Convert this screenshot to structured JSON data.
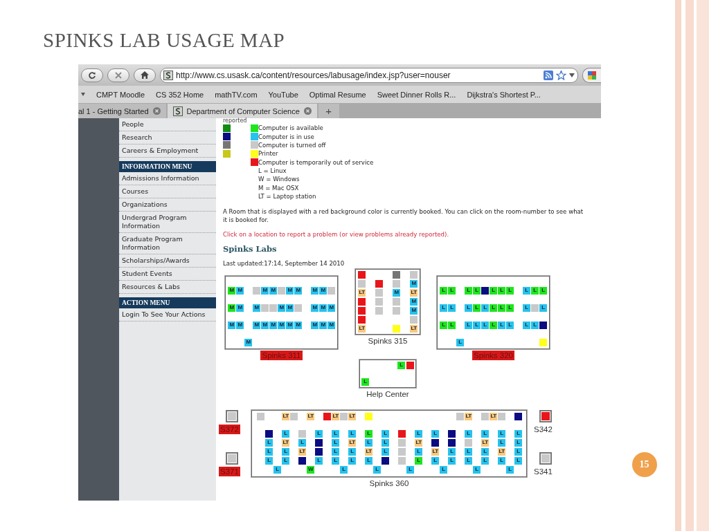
{
  "slide": {
    "title": "SPINKS LAB USAGE MAP",
    "page_number": "15"
  },
  "browser": {
    "url": "http://www.cs.usask.ca/content/resources/labusage/index.jsp?user=nouser",
    "bookmarks": [
      "CMPT Moodle",
      "CS 352 Home",
      "mathTV.com",
      "YouTube",
      "Optimal Resume",
      "Sweet Dinner Rolls R...",
      "Dijkstra's Shortest P..."
    ],
    "tabs": [
      {
        "label": "al 1 - Getting Started",
        "selected": false
      },
      {
        "label": "Department of Computer Science",
        "selected": true
      }
    ],
    "new_tab": "+"
  },
  "sidebar": {
    "sections": [
      {
        "items": [
          "People",
          "Research",
          "Careers & Employment"
        ]
      },
      {
        "header": "INFORMATION MENU",
        "items": [
          "Admissions Information",
          "Courses",
          "Organizations",
          "Undergrad Program Information",
          "Graduate Program Information",
          "Scholarships/Awards",
          "Student Events",
          "Resources & Labs"
        ]
      },
      {
        "header": "ACTION MENU",
        "items": [
          "Login To See Your Actions"
        ]
      }
    ]
  },
  "legend": {
    "heading": "reported",
    "items": [
      {
        "swatches": [
          {
            "color": "#128c12"
          },
          {
            "color": "#1ee61e"
          }
        ],
        "text": "Computer is available"
      },
      {
        "swatches": [
          {
            "color": "#0b0b82"
          },
          {
            "color": "#25c3ee"
          }
        ],
        "text": "Computer is in use"
      },
      {
        "swatches": [
          {
            "color": "#767676"
          },
          {
            "color": "#c9c9c9"
          }
        ],
        "text": "Computer is turned off"
      },
      {
        "swatches": [
          {
            "color": "#c9c71a"
          },
          {
            "color": "#ffff1a"
          }
        ],
        "text": "Printer"
      },
      {
        "swatches": [
          {
            "color": "#e8161a"
          }
        ],
        "text": "Computer is temporarily out of service"
      }
    ],
    "os_codes": [
      "L = Linux",
      "W = Windows",
      "M = Mac OSX",
      "LT = Laptop station"
    ]
  },
  "note": "A Room that is displayed with a red background color is currently booked. You can click on the room-number to see what it is booked for.",
  "report_link": "Click on a location to report a problem (or view problems already reported).",
  "heading": "Spinks Labs",
  "last_updated": "Last updated:17:14, September 14 2010",
  "rooms": [
    {
      "name": "Spinks 311",
      "booked": true,
      "rows": [
        [
          {
            "kind": "station",
            "color": "#1ee61e",
            "label": "M"
          },
          {
            "kind": "station",
            "color": "#25c3ee",
            "label": "M"
          },
          {
            "kind": "gap"
          },
          {
            "kind": "station",
            "color": "#c9c9c9"
          },
          {
            "kind": "station",
            "color": "#25c3ee",
            "label": "M"
          },
          {
            "kind": "station",
            "color": "#25c3ee",
            "label": "M"
          },
          {
            "kind": "station",
            "color": "#c9c9c9"
          },
          {
            "kind": "station",
            "color": "#25c3ee",
            "label": "M"
          },
          {
            "kind": "station",
            "color": "#25c3ee",
            "label": "M"
          },
          {
            "kind": "gap"
          },
          {
            "kind": "station",
            "color": "#25c3ee",
            "label": "M"
          },
          {
            "kind": "station",
            "color": "#25c3ee",
            "label": "M"
          },
          {
            "kind": "station",
            "color": "#c9c9c9"
          }
        ],
        [
          {
            "kind": "station",
            "color": "#1ee61e",
            "label": "M"
          },
          {
            "kind": "station",
            "color": "#25c3ee",
            "label": "M"
          },
          {
            "kind": "gap"
          },
          {
            "kind": "station",
            "color": "#25c3ee",
            "label": "M"
          },
          {
            "kind": "station",
            "color": "#c9c9c9"
          },
          {
            "kind": "station",
            "color": "#c9c9c9"
          },
          {
            "kind": "station",
            "color": "#25c3ee",
            "label": "M"
          },
          {
            "kind": "station",
            "color": "#25c3ee",
            "label": "M"
          },
          {
            "kind": "station",
            "color": "#c9c9c9"
          },
          {
            "kind": "gap"
          },
          {
            "kind": "station",
            "color": "#25c3ee",
            "label": "M"
          },
          {
            "kind": "station",
            "color": "#25c3ee",
            "label": "M"
          },
          {
            "kind": "station",
            "color": "#25c3ee",
            "label": "M"
          }
        ],
        [
          {
            "kind": "station",
            "color": "#25c3ee",
            "label": "M"
          },
          {
            "kind": "station",
            "color": "#25c3ee",
            "label": "M"
          },
          {
            "kind": "gap"
          },
          {
            "kind": "station",
            "color": "#25c3ee",
            "label": "M"
          },
          {
            "kind": "station",
            "color": "#25c3ee",
            "label": "M"
          },
          {
            "kind": "station",
            "color": "#25c3ee",
            "label": "M"
          },
          {
            "kind": "station",
            "color": "#25c3ee",
            "label": "M"
          },
          {
            "kind": "station",
            "color": "#25c3ee",
            "label": "M"
          },
          {
            "kind": "station",
            "color": "#25c3ee",
            "label": "M"
          },
          {
            "kind": "gap"
          },
          {
            "kind": "station",
            "color": "#25c3ee",
            "label": "M"
          },
          {
            "kind": "station",
            "color": "#25c3ee",
            "label": "M"
          },
          {
            "kind": "station",
            "color": "#25c3ee",
            "label": "M"
          }
        ],
        [
          {
            "kind": "gap"
          },
          {
            "kind": "gap"
          },
          {
            "kind": "station",
            "color": "#25c3ee",
            "label": "M"
          }
        ]
      ]
    },
    {
      "name": "Spinks 315",
      "booked": false,
      "rows": [
        [
          {
            "kind": "station",
            "color": "#e8161a"
          },
          {
            "kind": "gap"
          },
          {
            "kind": "station",
            "color": "#767676"
          },
          {
            "kind": "station",
            "color": "#c9c9c9"
          }
        ],
        [
          {
            "kind": "station",
            "color": "#c9c9c9"
          },
          {
            "kind": "station",
            "color": "#e8161a"
          },
          {
            "kind": "station",
            "color": "#c9c9c9"
          },
          {
            "kind": "station",
            "color": "#25c3ee",
            "label": "M"
          }
        ],
        [
          {
            "kind": "station",
            "color": "#f8c97c",
            "label": "LT"
          },
          {
            "kind": "station",
            "color": "#c9c9c9"
          },
          {
            "kind": "station",
            "color": "#25c3ee",
            "label": "M"
          },
          {
            "kind": "station",
            "color": "#f8c97c",
            "label": "LT"
          }
        ],
        [
          {
            "kind": "station",
            "color": "#e8161a"
          },
          {
            "kind": "station",
            "color": "#c9c9c9"
          },
          {
            "kind": "station",
            "color": "#c9c9c9"
          },
          {
            "kind": "station",
            "color": "#25c3ee",
            "label": "M"
          }
        ],
        [
          {
            "kind": "station",
            "color": "#e8161a"
          },
          {
            "kind": "station",
            "color": "#c9c9c9"
          },
          {
            "kind": "station",
            "color": "#c9c9c9"
          },
          {
            "kind": "station",
            "color": "#25c3ee",
            "label": "M"
          }
        ],
        [
          {
            "kind": "station",
            "color": "#e8161a"
          },
          {
            "kind": "gap"
          },
          {
            "kind": "gap"
          },
          {
            "kind": "station",
            "color": "#c9c9c9"
          }
        ],
        [
          {
            "kind": "station",
            "color": "#f8c97c",
            "label": "LT"
          },
          {
            "kind": "gap"
          },
          {
            "kind": "station",
            "color": "#ffff1a"
          },
          {
            "kind": "station",
            "color": "#f8c97c",
            "label": "LT"
          }
        ]
      ]
    },
    {
      "name": "Spinks 320",
      "booked": true,
      "rows": [
        [
          {
            "kind": "station",
            "color": "#1ee61e",
            "label": "L"
          },
          {
            "kind": "station",
            "color": "#1ee61e",
            "label": "L"
          },
          {
            "kind": "gap"
          },
          {
            "kind": "station",
            "color": "#1ee61e",
            "label": "L"
          },
          {
            "kind": "station",
            "color": "#1ee61e",
            "label": "L"
          },
          {
            "kind": "station",
            "color": "#0b0b82"
          },
          {
            "kind": "station",
            "color": "#1ee61e",
            "label": "L"
          },
          {
            "kind": "station",
            "color": "#1ee61e",
            "label": "L"
          },
          {
            "kind": "station",
            "color": "#1ee61e",
            "label": "L"
          },
          {
            "kind": "gap"
          },
          {
            "kind": "station",
            "color": "#25c3ee",
            "label": "L"
          },
          {
            "kind": "station",
            "color": "#1ee61e",
            "label": "L"
          },
          {
            "kind": "station",
            "color": "#1ee61e",
            "label": "L"
          }
        ],
        [
          {
            "kind": "station",
            "color": "#25c3ee",
            "label": "L"
          },
          {
            "kind": "station",
            "color": "#25c3ee",
            "label": "L"
          },
          {
            "kind": "gap"
          },
          {
            "kind": "station",
            "color": "#25c3ee",
            "label": "L"
          },
          {
            "kind": "station",
            "color": "#1ee61e",
            "label": "L"
          },
          {
            "kind": "station",
            "color": "#25c3ee",
            "label": "L"
          },
          {
            "kind": "station",
            "color": "#1ee61e",
            "label": "L"
          },
          {
            "kind": "station",
            "color": "#1ee61e",
            "label": "L"
          },
          {
            "kind": "station",
            "color": "#1ee61e",
            "label": "L"
          },
          {
            "kind": "gap"
          },
          {
            "kind": "station",
            "color": "#25c3ee",
            "label": "L"
          },
          {
            "kind": "station",
            "color": "#c9c9c9"
          },
          {
            "kind": "station",
            "color": "#25c3ee",
            "label": "L"
          }
        ],
        [
          {
            "kind": "station",
            "color": "#1ee61e",
            "label": "L"
          },
          {
            "kind": "station",
            "color": "#1ee61e",
            "label": "L"
          },
          {
            "kind": "gap"
          },
          {
            "kind": "station",
            "color": "#25c3ee",
            "label": "L"
          },
          {
            "kind": "station",
            "color": "#25c3ee",
            "label": "L"
          },
          {
            "kind": "station",
            "color": "#25c3ee",
            "label": "L"
          },
          {
            "kind": "station",
            "color": "#1ee61e",
            "label": "L"
          },
          {
            "kind": "station",
            "color": "#25c3ee",
            "label": "L"
          },
          {
            "kind": "station",
            "color": "#25c3ee",
            "label": "L"
          },
          {
            "kind": "gap"
          },
          {
            "kind": "station",
            "color": "#25c3ee",
            "label": "L"
          },
          {
            "kind": "station",
            "color": "#25c3ee",
            "label": "L"
          },
          {
            "kind": "station",
            "color": "#0b0b82"
          }
        ],
        [
          {
            "kind": "gap"
          },
          {
            "kind": "gap"
          },
          {
            "kind": "station",
            "color": "#25c3ee",
            "label": "L"
          },
          {
            "kind": "gap"
          },
          {
            "kind": "gap"
          },
          {
            "kind": "gap"
          },
          {
            "kind": "gap"
          },
          {
            "kind": "gap"
          },
          {
            "kind": "gap"
          },
          {
            "kind": "gap"
          },
          {
            "kind": "gap"
          },
          {
            "kind": "gap"
          },
          {
            "kind": "station",
            "color": "#ffff1a"
          }
        ]
      ]
    },
    {
      "name": "Help Center",
      "booked": false,
      "rows": [
        [
          {
            "kind": "gap"
          },
          {
            "kind": "gap"
          },
          {
            "kind": "gap"
          },
          {
            "kind": "gap"
          },
          {
            "kind": "station",
            "color": "#1ee61e",
            "label": "L"
          },
          {
            "kind": "station",
            "color": "#e8161a"
          }
        ],
        [
          {
            "kind": "gap"
          }
        ],
        [
          {
            "kind": "station",
            "color": "#1ee61e",
            "label": "L"
          }
        ]
      ]
    }
  ],
  "spinks_360": {
    "name": "Spinks 360",
    "booked": false,
    "top_row": [
      {
        "kind": "station",
        "color": "#c9c9c9"
      },
      {
        "kind": "gap"
      },
      {
        "kind": "gap"
      },
      {
        "kind": "station",
        "color": "#f8c97c",
        "label": "LT"
      },
      {
        "kind": "station",
        "color": "#c9c9c9"
      },
      {
        "kind": "gap"
      },
      {
        "kind": "station",
        "color": "#f8c97c",
        "label": "LT"
      },
      {
        "kind": "gap"
      },
      {
        "kind": "station",
        "color": "#e8161a"
      },
      {
        "kind": "station",
        "color": "#f8c97c",
        "label": "LT"
      },
      {
        "kind": "station",
        "color": "#c9c9c9"
      },
      {
        "kind": "station",
        "color": "#f8c97c",
        "label": "LT"
      },
      {
        "kind": "gap"
      },
      {
        "kind": "station",
        "color": "#ffff1a"
      },
      {
        "kind": "gap"
      },
      {
        "kind": "gap"
      },
      {
        "kind": "gap"
      },
      {
        "kind": "gap"
      },
      {
        "kind": "gap"
      },
      {
        "kind": "gap"
      },
      {
        "kind": "gap"
      },
      {
        "kind": "gap"
      },
      {
        "kind": "gap"
      },
      {
        "kind": "gap"
      },
      {
        "kind": "station",
        "color": "#c9c9c9"
      },
      {
        "kind": "station",
        "color": "#f8c97c",
        "label": "LT"
      },
      {
        "kind": "gap"
      },
      {
        "kind": "station",
        "color": "#c9c9c9"
      },
      {
        "kind": "station",
        "color": "#f8c97c",
        "label": "LT"
      },
      {
        "kind": "station",
        "color": "#c9c9c9"
      },
      {
        "kind": "gap"
      },
      {
        "kind": "station",
        "color": "#0b0b82"
      }
    ],
    "desk_columns": [
      [
        {
          "kind": "station",
          "color": "#0b0b82"
        },
        {
          "kind": "station",
          "color": "#25c3ee",
          "label": "L"
        },
        {
          "kind": "station",
          "color": "#25c3ee",
          "label": "L"
        },
        {
          "kind": "station",
          "color": "#25c3ee",
          "label": "L"
        }
      ],
      [
        {
          "kind": "station",
          "color": "#25c3ee",
          "label": "L"
        },
        {
          "kind": "station",
          "color": "#f8c97c",
          "label": "LT"
        },
        {
          "kind": "station",
          "color": "#25c3ee",
          "label": "L"
        },
        {
          "kind": "station",
          "color": "#25c3ee",
          "label": "L"
        }
      ],
      [
        {
          "kind": "station",
          "color": "#c9c9c9"
        },
        {
          "kind": "station",
          "color": "#25c3ee",
          "label": "L"
        },
        {
          "kind": "station",
          "color": "#f8c97c",
          "label": "LT"
        },
        {
          "kind": "station",
          "color": "#0b0b82"
        }
      ],
      [
        {
          "kind": "station",
          "color": "#25c3ee",
          "label": "L"
        },
        {
          "kind": "station",
          "color": "#0b0b82"
        },
        {
          "kind": "station",
          "color": "#0b0b82"
        },
        {
          "kind": "station",
          "color": "#25c3ee",
          "label": "L"
        }
      ],
      [
        {
          "kind": "station",
          "color": "#25c3ee",
          "label": "L"
        },
        {
          "kind": "station",
          "color": "#25c3ee",
          "label": "L"
        },
        {
          "kind": "station",
          "color": "#25c3ee",
          "label": "L"
        },
        {
          "kind": "station",
          "color": "#25c3ee",
          "label": "L"
        }
      ],
      [
        {
          "kind": "station",
          "color": "#25c3ee",
          "label": "L"
        },
        {
          "kind": "station",
          "color": "#f8c97c",
          "label": "LT"
        },
        {
          "kind": "station",
          "color": "#25c3ee",
          "label": "L"
        },
        {
          "kind": "station",
          "color": "#25c3ee",
          "label": "L"
        }
      ],
      [
        {
          "kind": "station",
          "color": "#1ee61e",
          "label": "L"
        },
        {
          "kind": "station",
          "color": "#25c3ee",
          "label": "L"
        },
        {
          "kind": "station",
          "color": "#f8c97c",
          "label": "LT"
        },
        {
          "kind": "station",
          "color": "#25c3ee",
          "label": "L"
        }
      ],
      [
        {
          "kind": "station",
          "color": "#25c3ee",
          "label": "L"
        },
        {
          "kind": "station",
          "color": "#25c3ee",
          "label": "L"
        },
        {
          "kind": "station",
          "color": "#25c3ee",
          "label": "L"
        },
        {
          "kind": "station",
          "color": "#0b0b82"
        }
      ],
      [
        {
          "kind": "station",
          "color": "#e8161a"
        },
        {
          "kind": "station",
          "color": "#c9c9c9"
        },
        {
          "kind": "station",
          "color": "#c9c9c9"
        },
        {
          "kind": "station",
          "color": "#c9c9c9"
        }
      ],
      [
        {
          "kind": "station",
          "color": "#25c3ee",
          "label": "L"
        },
        {
          "kind": "station",
          "color": "#f8c97c",
          "label": "LT"
        },
        {
          "kind": "station",
          "color": "#25c3ee",
          "label": "L"
        },
        {
          "kind": "station",
          "color": "#1ee61e",
          "label": "L"
        }
      ],
      [
        {
          "kind": "station",
          "color": "#25c3ee",
          "label": "L"
        },
        {
          "kind": "station",
          "color": "#0b0b82"
        },
        {
          "kind": "station",
          "color": "#f8c97c",
          "label": "LT"
        },
        {
          "kind": "station",
          "color": "#25c3ee",
          "label": "L"
        }
      ],
      [
        {
          "kind": "station",
          "color": "#0b0b82"
        },
        {
          "kind": "station",
          "color": "#0b0b82"
        },
        {
          "kind": "station",
          "color": "#25c3ee",
          "label": "L"
        },
        {
          "kind": "station",
          "color": "#25c3ee",
          "label": "L"
        }
      ],
      [
        {
          "kind": "station",
          "color": "#25c3ee",
          "label": "L"
        },
        {
          "kind": "station",
          "color": "#c9c9c9"
        },
        {
          "kind": "station",
          "color": "#25c3ee",
          "label": "L"
        },
        {
          "kind": "station",
          "color": "#25c3ee",
          "label": "L"
        }
      ],
      [
        {
          "kind": "station",
          "color": "#25c3ee",
          "label": "L"
        },
        {
          "kind": "station",
          "color": "#f8c97c",
          "label": "LT"
        },
        {
          "kind": "station",
          "color": "#25c3ee",
          "label": "L"
        },
        {
          "kind": "station",
          "color": "#25c3ee",
          "label": "L"
        }
      ],
      [
        {
          "kind": "station",
          "color": "#25c3ee",
          "label": "L"
        },
        {
          "kind": "station",
          "color": "#25c3ee",
          "label": "L"
        },
        {
          "kind": "station",
          "color": "#f8c97c",
          "label": "LT"
        },
        {
          "kind": "station",
          "color": "#25c3ee",
          "label": "L"
        }
      ],
      [
        {
          "kind": "station",
          "color": "#25c3ee",
          "label": "L"
        },
        {
          "kind": "station",
          "color": "#25c3ee",
          "label": "L"
        },
        {
          "kind": "station",
          "color": "#25c3ee",
          "label": "L"
        },
        {
          "kind": "station",
          "color": "#25c3ee",
          "label": "L"
        }
      ]
    ],
    "end_stations": [
      {
        "kind": "station",
        "color": "#25c3ee",
        "label": "L"
      },
      {
        "kind": "station",
        "color": "#1ee61e",
        "label": "W"
      },
      {
        "kind": "station",
        "color": "#25c3ee",
        "label": "L"
      },
      {
        "kind": "station",
        "color": "#25c3ee",
        "label": "L"
      },
      {
        "kind": "station",
        "color": "#25c3ee",
        "label": "L"
      },
      {
        "kind": "station",
        "color": "#25c3ee",
        "label": "L"
      },
      {
        "kind": "station",
        "color": "#25c3ee",
        "label": "L"
      },
      {
        "kind": "station",
        "color": "#25c3ee",
        "label": "L"
      }
    ]
  },
  "small_rooms_left": [
    {
      "name": "S372",
      "booked": true,
      "station": {
        "kind": "station",
        "color": "#c9c9c9"
      }
    },
    {
      "name": "S371",
      "booked": true,
      "station": {
        "kind": "station",
        "color": "#c9c9c9"
      }
    }
  ],
  "small_rooms_right": [
    {
      "name": "S342",
      "booked": false,
      "station": {
        "kind": "station",
        "color": "#e8161a"
      }
    },
    {
      "name": "S341",
      "booked": false,
      "station": {
        "kind": "station",
        "color": "#c9c9c9"
      }
    }
  ]
}
